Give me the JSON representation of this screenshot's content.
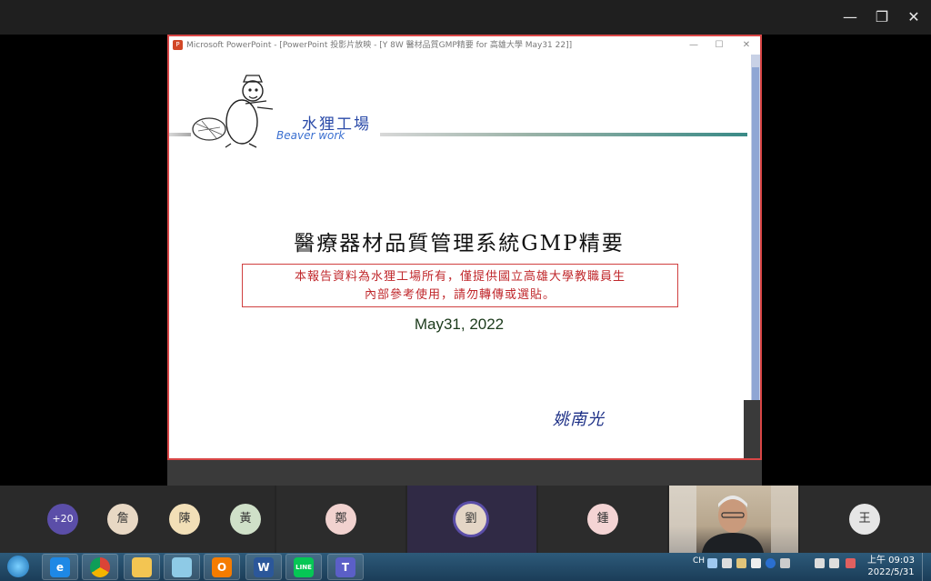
{
  "window_controls": {
    "minimize": "—",
    "restore": "❐",
    "close": "✕"
  },
  "ppt": {
    "title": "Microsoft PowerPoint - [PowerPoint 投影片放映 - [Y 8W 醫材品質GMP精要 for 高雄大學 May31 22]]",
    "icon_letter": "P",
    "minimize": "—",
    "maximize": "☐",
    "close": "✕"
  },
  "slide": {
    "logo_cn": "水狸工場",
    "logo_en": "Beaver work",
    "title": "醫療器材品質管理系統GMP精要",
    "notice_line1": "本報告資料為水狸工場所有，僅提供國立高雄大學教職員生",
    "notice_line2": "內部參考使用，請勿轉傳或選貼。",
    "date": "May31, 2022",
    "author": "姚南光"
  },
  "participants": {
    "more": "+20",
    "p1": "詹",
    "p2": "陳",
    "p3": "黃",
    "p4": "鄭",
    "p5": "劉",
    "p6": "鍾",
    "p7": "王"
  },
  "taskbar": {
    "apps": [
      "start-icon",
      "ie-icon",
      "chrome-icon",
      "explorer-icon",
      "notepad-icon",
      "outlook-icon",
      "word-icon",
      "line-icon",
      "teams-icon"
    ],
    "word_letter": "W",
    "line_label": "LINE",
    "teams_letter": "T",
    "lang": "CH",
    "time": "上午 09:03",
    "date": "2022/5/31"
  },
  "colors": {
    "accent_red": "#d94646",
    "slide_title": "#111111",
    "notice": "#c0282c",
    "author": "#1c2f86",
    "active_speaker": "#5b4ea8"
  }
}
